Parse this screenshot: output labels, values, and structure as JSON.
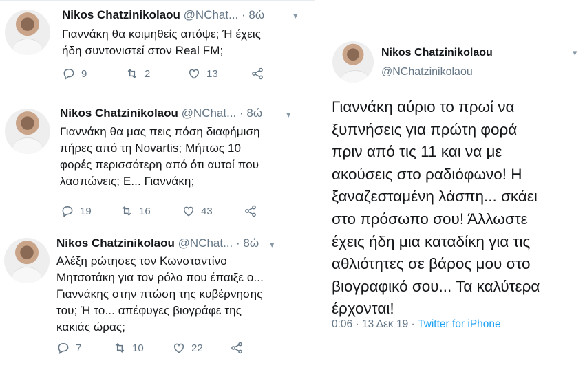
{
  "left_tweets": [
    {
      "name": "Nikos Chatzinikolaou",
      "handle": "@NChat...",
      "dot": "·",
      "time": "8ώ",
      "text_lines": [
        "Γιαννάκη θα κοιμηθείς απόψε; Ή έχεις",
        "ήδη συντονιστεί στον Real FM;"
      ],
      "replies": "9",
      "retweets": "2",
      "likes": "13"
    },
    {
      "name": "Nikos Chatzinikolaou",
      "handle": "@NChat...",
      "dot": "·",
      "time": "8ώ",
      "text_lines": [
        "Γιαννάκη θα μας πεις πόση διαφήμιση",
        "πήρες από τη Novartis; Μήπως 10",
        "φορές περισσότερη από ότι αυτοί που",
        "λασπώνεις; Ε... Γιαννάκη;"
      ],
      "replies": "19",
      "retweets": "16",
      "likes": "43"
    },
    {
      "name": "Nikos Chatzinikolaou",
      "handle": "@NChat...",
      "dot": "·",
      "time": "8ώ",
      "text_lines": [
        "Αλέξη ρώτησες τον Κωνσταντίνο",
        "Μητσοτάκη για τον ρόλο που έπαιξε ο...",
        "Γιαννάκης στην πτώση της κυβέρνησης",
        "του; Ή το... απέφυγες βιογράφε της",
        "κακιάς ώρας;"
      ],
      "replies": "7",
      "retweets": "10",
      "likes": "22"
    }
  ],
  "right_tweet": {
    "name": "Nikos Chatzinikolaou",
    "handle": "@NChatzinikolaou",
    "text_lines": [
      "Γιαννάκη αύριο το πρωί να",
      "ξυπνήσεις για πρώτη φορά",
      "πριν από τις 11 και να με",
      "ακούσεις στο ραδιόφωνο! Η",
      "ξαναζεσταμένη λάσπη... σκάει",
      "στο πρόσωπο σου! Άλλωστε",
      "έχεις ήδη μια καταδίκη για τις",
      "αθλιότητες σε βάρος μου στο",
      "βιογραφικό σου... Τα καλύτερα",
      "έρχονται!"
    ],
    "time": "0:06",
    "sep1": "·",
    "date": "13 Δεκ 19",
    "sep2": "·",
    "source": "Twitter for iPhone"
  },
  "colors": {
    "text": "#14171a",
    "secondary": "#657786",
    "link": "#1da1f2"
  },
  "icons": [
    "reply-icon",
    "retweet-icon",
    "like-icon",
    "share-icon",
    "chevron-down-icon"
  ]
}
